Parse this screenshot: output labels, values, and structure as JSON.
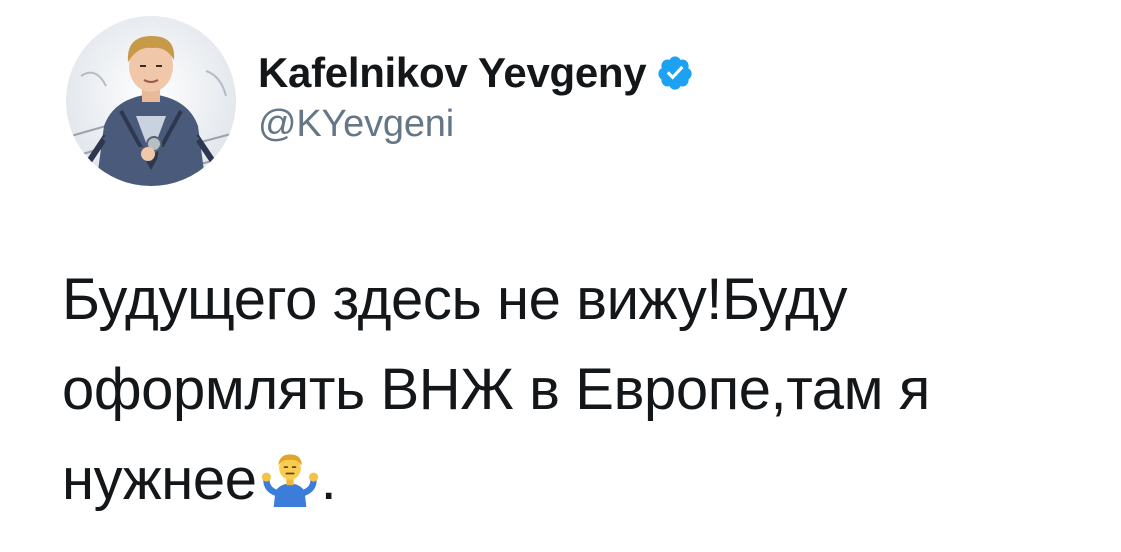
{
  "tweet": {
    "author": {
      "display_name": "Kafelnikov Yevgeny",
      "handle": "@KYevgeni",
      "verified": true,
      "verified_icon": "verified-badge-icon",
      "verified_color": "#1da1f2"
    },
    "text": {
      "line1": "Будущего здесь не вижу!Буду",
      "line2": "оформлять ВНЖ в Европе,там я",
      "line3_before_emoji": "нужнее",
      "emoji": "person-shrugging-icon",
      "line3_after_emoji": "."
    }
  },
  "colors": {
    "text": "#14171a",
    "secondary_text": "#657786",
    "background": "#ffffff"
  }
}
